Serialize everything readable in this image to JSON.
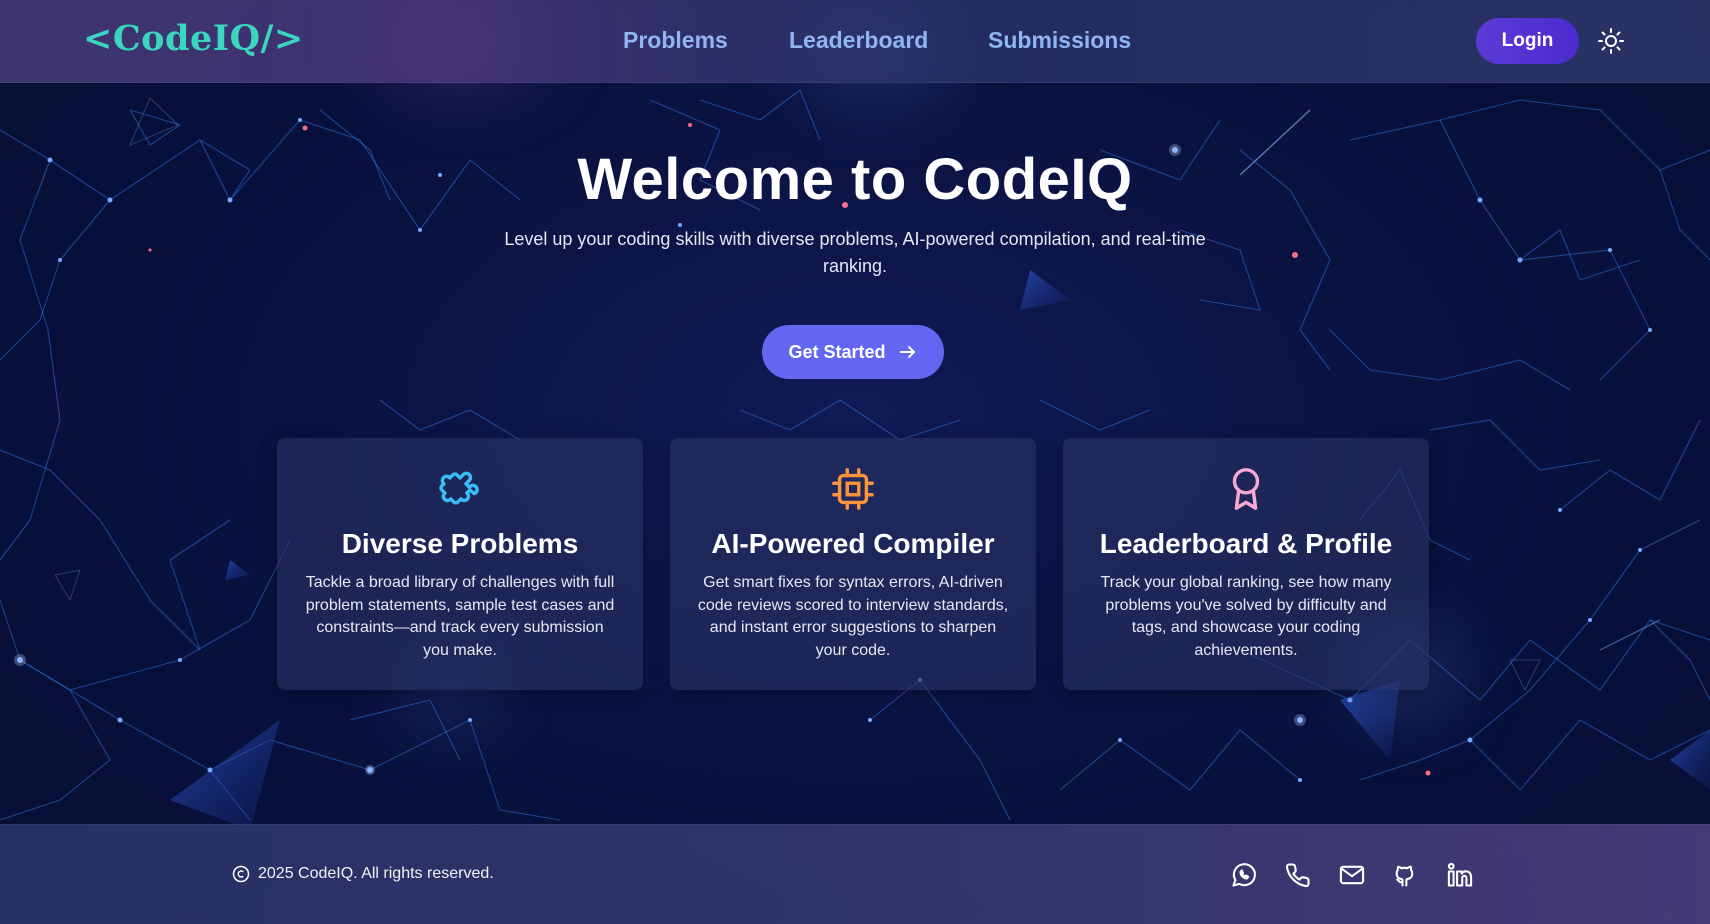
{
  "header": {
    "logo": "<CodeIQ/>",
    "nav": [
      "Problems",
      "Leaderboard",
      "Submissions"
    ],
    "login_label": "Login",
    "theme_icon": "sun-icon"
  },
  "hero": {
    "title": "Welcome to CodeIQ",
    "subtitle": "Level up your coding skills with diverse problems, AI-powered compilation, and real-time ranking.",
    "cta_label": "Get Started",
    "cta_icon": "arrow-right-icon"
  },
  "features": [
    {
      "icon": "puzzle-icon",
      "icon_color": "#38bdf8",
      "title": "Diverse Problems",
      "description": "Tackle a broad library of challenges with full problem statements, sample test cases and constraints—and track every submission you make."
    },
    {
      "icon": "cpu-chip-icon",
      "icon_color": "#fb923c",
      "title": "AI-Powered Compiler",
      "description": "Get smart fixes for syntax errors, AI-driven code reviews scored to interview standards, and instant error suggestions to sharpen your code."
    },
    {
      "icon": "award-ribbon-icon",
      "icon_color": "#f9a8d4",
      "title": "Leaderboard & Profile",
      "description": "Track your global ranking, see how many problems you've solved by difficulty and tags, and showcase your coding achievements."
    }
  ],
  "footer": {
    "copyright": "2025 CodeIQ. All rights reserved.",
    "social": [
      "whatsapp-icon",
      "phone-icon",
      "mail-icon",
      "github-icon",
      "linkedin-icon"
    ]
  },
  "colors": {
    "accent": "#6366f1",
    "logo": "#3ad6c0",
    "nav": "#8fb6f2",
    "login": "#5b3bd6"
  }
}
